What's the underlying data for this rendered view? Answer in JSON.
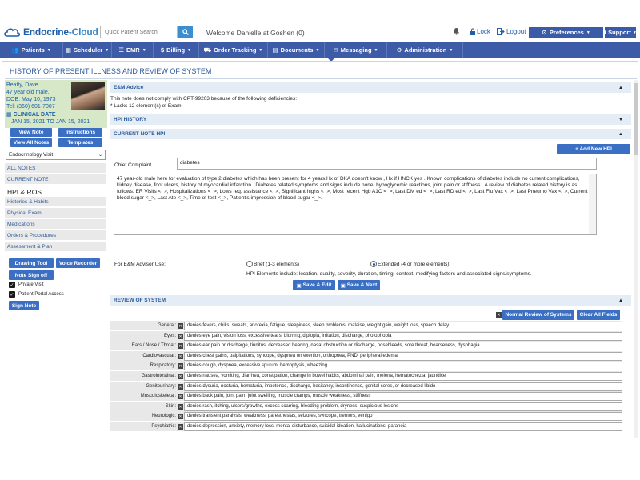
{
  "header": {
    "logo_a": "Endocrine",
    "logo_b": "-Cloud",
    "search_placeholder": "Quick Patient Search",
    "welcome": "Welcome Danielle at Goshen (0)",
    "lock": "Lock",
    "logout": "Logout",
    "preferences": "Preferences",
    "support": "Support"
  },
  "nav": [
    {
      "label": "Patients",
      "icon": "people-icon"
    },
    {
      "label": "Scheduler",
      "icon": "scheduler-icon"
    },
    {
      "label": "EMR",
      "icon": "emr-icon"
    },
    {
      "label": "Billing",
      "icon": "dollar-icon"
    },
    {
      "label": "Order Tracking",
      "icon": "truck-icon"
    },
    {
      "label": "Documents",
      "icon": "documents-icon"
    },
    {
      "label": "Messaging",
      "icon": "envelope-icon"
    },
    {
      "label": "Administration",
      "icon": "admin-icon"
    }
  ],
  "page_title": "HISTORY OF PRESENT ILLNESS AND REVIEW OF SYSTEM",
  "patient": {
    "name": "Beatty, Dave",
    "age": "47 year old male,",
    "dob": "DOB: May 10, 1973",
    "tel": "Tel: (360) 601-7007",
    "clinical_date_label": "CLINICAL DATE",
    "clinical_date": "JAN 15, 2021 TO JAN 15, 2021"
  },
  "left_buttons": {
    "view_note": "View Note",
    "instructions": "Instructions",
    "view_all_notes": "View All Notes",
    "templates": "Templates"
  },
  "visit_select": "Endocrinology Visit",
  "side_links": [
    "ALL NOTES",
    "CURRENT NOTE",
    "HPI & ROS",
    "Histories & Habits",
    "Physical Exam",
    "Medications",
    "Orders & Procedures",
    "Assessment & Plan"
  ],
  "tools": {
    "drawing_tool": "Drawing Tool",
    "voice_recorder": "Voice Recorder",
    "note_sign_off": "Note Sign off",
    "private_visit": "Private Visit",
    "patient_portal": "Patient Portal Access",
    "sign_note": "Sign Note"
  },
  "em_advice": {
    "title": "E&M Advice",
    "line1": "This note does not comply with CPT-99203 because of the following deficiencies:",
    "line2": "* Lacks 12 element(s) of Exam"
  },
  "hpi_history_title": "HPI HISTORY",
  "current_note_hpi_title": "CURRENT NOTE HPI",
  "add_new_hpi": "+ Add New HPI",
  "chief_complaint_label": "Chief Complaint",
  "chief_complaint_value": "diabetes",
  "hpi_text": "47 year-old male here for evaluation of type 2 diabetes which has been present for 4 years.Hx of DKA doesn't know , Hx if HNCK yes . Known complications of diabetes include no current complications, kidney disease, foot ulcers, history of myocardial infarction . Diabetes related symptoms and signs include none, hypoglycemic reactions, joint pain or stiffness . A review of diabetes related history is as follows. ER Visits <_>, Hospitalizations <_>, Lows req. assistance <_>, Significant highs <_>, Most recent Hgb A1C <_>, Last DM ed <_>, Last RD ed <_>, Last Flu Vax <_>, Last Pneumo Vax <_>, Current blood sugar <_>, Last Ate <_>, Time of test <_>, Patient's impression of blood sugar <_>.",
  "em_advisor": {
    "label": "For E&M Advisor Use:",
    "brief": "Brief (1-3 elements)",
    "extended": "Extended (4 or more elements)",
    "selected": "extended",
    "elements": "HPI Elements include: location, quality, severity, duration, timing, context, modifying factors and associated signs/symptoms."
  },
  "save_edit": "Save & Edit",
  "save_next": "Save & Next",
  "ros": {
    "title": "REVIEW OF SYSTEM",
    "normal_btn": "Normal Review of Systems",
    "clear_btn": "Clear All Fields",
    "rows": [
      {
        "label": "General:",
        "value": "denies fevers, chills, sweats, anorexia, fatigue, sleepiness, sleep problems, malaise, weight gain, weight loss, speech delay"
      },
      {
        "label": "Eyes:",
        "value": "denies eye pain, vision loss, excessive tears, blurring, diplopia, irritation, discharge, photophobia"
      },
      {
        "label": "Ears / Nose / Throat:",
        "value": "denies ear pain or discharge, tinnitus, decreased hearing, nasal obstruction or discharge, nosebleeds, sore throat, hoarseness, dysphagia"
      },
      {
        "label": "Cardiovascular:",
        "value": "denies chest pains, palpitations, syncope, dyspnea on exertion, orthopnea, PND, peripheral edema"
      },
      {
        "label": "Respiratory:",
        "value": "denies cough, dyspnea, excessive sputum, hemoptysis, wheezing"
      },
      {
        "label": "Gastrointestinal:",
        "value": "denies nausea, vomiting, diarrhea, constipation, change in bowel habits, abdominal pain, melena, hematochezia, jaundice"
      },
      {
        "label": "Genitourinary:",
        "value": "denies dysuria, nocturia, hematuria, impotence, discharge, hesitancy, incontinence, genital sores, or decreased libido"
      },
      {
        "label": "Musculoskeletal:",
        "value": "denies back pain, joint pain, joint swelling, muscle cramps, muscle weakness, stiffness"
      },
      {
        "label": "Skin:",
        "value": "denies rash, itching, ulcers/growths, excess scarring, bleeding problem, dryness, suspicious lesions"
      },
      {
        "label": "Neurologic:",
        "value": "denies transient paralysis, weakness, paresthesias, seizures, syncope, tremors, vertigo"
      },
      {
        "label": "Psychiatric:",
        "value": "denies depression, anxiety, memory loss, mental disturbance, suicidal ideation, hallucinations, paranoia"
      }
    ]
  },
  "colors": {
    "nav": "#3d5ba6",
    "button": "#3a6fc4",
    "section": "#e4ecf5",
    "patient_bg": "#d6e8c8"
  }
}
